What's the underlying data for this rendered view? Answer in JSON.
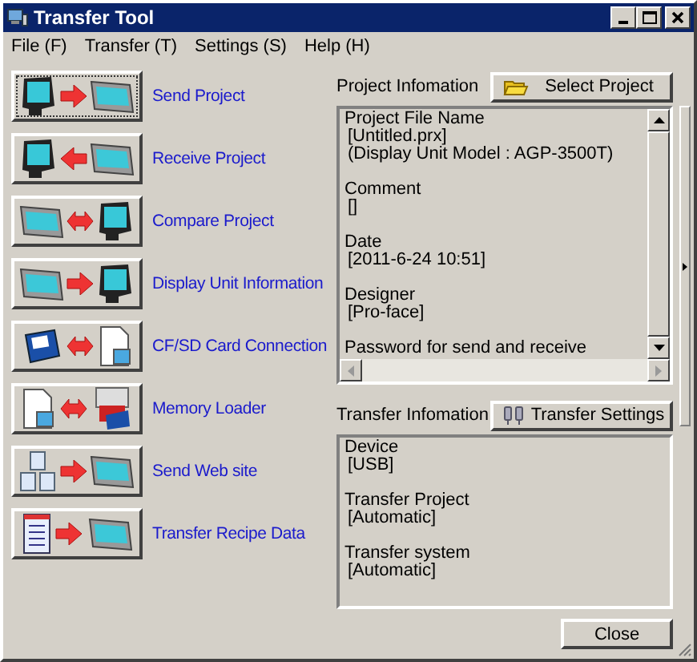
{
  "window": {
    "title": "Transfer Tool"
  },
  "menu": [
    "File (F)",
    "Transfer (T)",
    "Settings (S)",
    "Help (H)"
  ],
  "actions": [
    {
      "label": "Send Project",
      "focused": true
    },
    {
      "label": "Receive Project",
      "focused": false
    },
    {
      "label": "Compare Project",
      "focused": false
    },
    {
      "label": "Display Unit Information",
      "focused": false
    },
    {
      "label": "CF/SD Card Connection",
      "focused": false
    },
    {
      "label": "Memory Loader",
      "focused": false
    },
    {
      "label": "Send Web site",
      "focused": false
    },
    {
      "label": "Transfer Recipe Data",
      "focused": false
    }
  ],
  "project_info": {
    "label": "Project Infomation",
    "button": "Select Project",
    "groups": [
      {
        "heading": "Project File Name",
        "values": [
          "[Untitled.prx]",
          "(Display Unit Model : AGP-3500T)"
        ]
      },
      {
        "heading": "Comment",
        "values": [
          "[]"
        ]
      },
      {
        "heading": "Date",
        "values": [
          "[2011-6-24 10:51]"
        ]
      },
      {
        "heading": "Designer",
        "values": [
          "[Pro-face]"
        ]
      },
      {
        "heading": "Password for send and receive"
      }
    ]
  },
  "transfer_info": {
    "label": "Transfer Infomation",
    "button": "Transfer Settings",
    "groups": [
      {
        "heading": "Device",
        "values": [
          "[USB]"
        ]
      },
      {
        "heading": "Transfer Project",
        "values": [
          "[Automatic]"
        ]
      },
      {
        "heading": "Transfer system",
        "values": [
          "[Automatic]"
        ]
      }
    ]
  },
  "close_button": "Close"
}
